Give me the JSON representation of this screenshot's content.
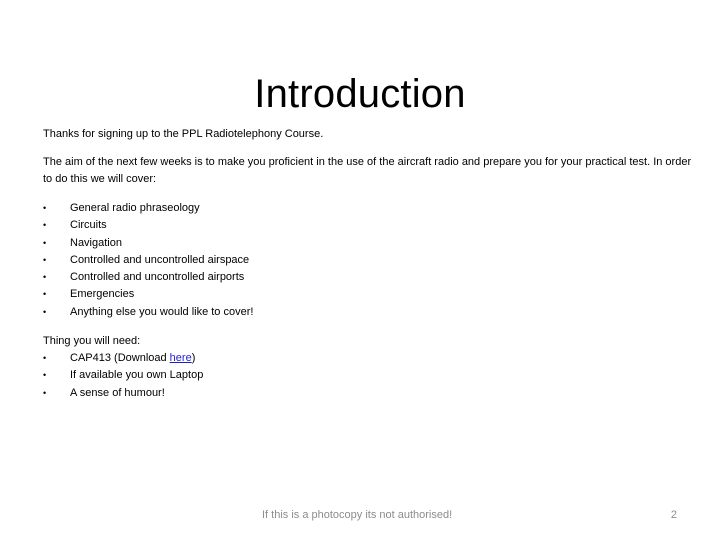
{
  "slide": {
    "title": "Introduction",
    "intro": "Thanks for signing up to the PPL Radiotelephony Course.",
    "aim": "The aim of the next few weeks is to make you proficient in the use of the aircraft radio and prepare you for your practical test. In order to do this we will cover:",
    "bullet_glyph": "•",
    "topics": [
      "General radio phraseology",
      "Circuits",
      "Navigation",
      "Controlled and uncontrolled airspace",
      "Controlled and uncontrolled airports",
      "Emergencies",
      "Anything else you would like to cover!"
    ],
    "needs_heading": "Thing you will need:",
    "needs": {
      "item1_prefix": "CAP413 (Download ",
      "item1_link": "here",
      "item1_suffix": ")",
      "item2": "If available you own Laptop",
      "item3": "A sense of humour!"
    },
    "footer": "If this is a photocopy its not authorised!",
    "page_number": "2",
    "colors": {
      "link": "#1f1fd1",
      "footer_text": "#8c8c8c"
    }
  }
}
